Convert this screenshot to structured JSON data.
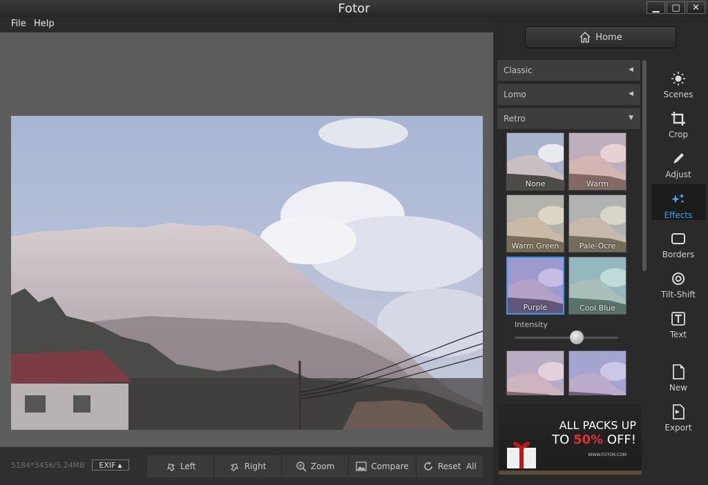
{
  "window": {
    "title": "Fotor",
    "minimize": "▁",
    "maximize": "□",
    "close": "✕"
  },
  "menu": {
    "file": "File",
    "help": "Help"
  },
  "status": {
    "dimensions": "5184*3456/5.24MB",
    "exif": "EXIF"
  },
  "toolbar": {
    "left": "Left",
    "right": "Right",
    "zoom": "Zoom",
    "compare": "Compare",
    "reset": "Reset  All"
  },
  "home": {
    "label": "Home"
  },
  "categories": {
    "classic": "Classic",
    "lomo": "Lomo",
    "retro": "Retro"
  },
  "effects": [
    {
      "label": "None",
      "tint": "none"
    },
    {
      "label": "Warm",
      "tint": "#e8a49a"
    },
    {
      "label": "Warm Green",
      "tint": "#c8b070"
    },
    {
      "label": "Pale-Ocre",
      "tint": "#c0b080"
    },
    {
      "label": "Purple",
      "tint": "#8a6ad0"
    },
    {
      "label": "Cool Blue",
      "tint": "#70c0a8"
    }
  ],
  "selected_effect": "Purple",
  "intensity": {
    "label": "Intensity",
    "value": 0.6
  },
  "ad": {
    "line1": "ALL PACKS UP",
    "line2_prefix": "TO",
    "line2_pct": "50%",
    "line2_suffix": "OFF!",
    "url": "WWW.FOTOR.COM"
  },
  "sidebar": {
    "scenes": "Scenes",
    "crop": "Crop",
    "adjust": "Adjust",
    "effects": "Effects",
    "borders": "Borders",
    "tiltshift": "Tilt-Shift",
    "text": "Text",
    "new": "New",
    "export": "Export"
  },
  "colors": {
    "accent": "#3c98ee",
    "panel": "#2a2a2a",
    "canvas": "#5c5c5c"
  }
}
